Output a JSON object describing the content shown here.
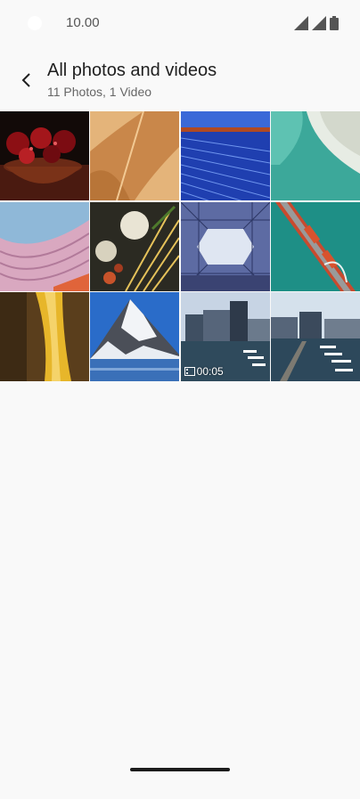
{
  "status_bar": {
    "time": "10.00",
    "icons": [
      "signal-icon",
      "signal-icon",
      "battery-icon"
    ]
  },
  "header": {
    "back_icon": "chevron-left-icon",
    "title": "All photos and videos",
    "subtitle": "11 Photos, 1 Video"
  },
  "grid": {
    "items": [
      {
        "kind": "photo",
        "subject": "pomegranates"
      },
      {
        "kind": "photo",
        "subject": "sand-dune"
      },
      {
        "kind": "photo",
        "subject": "blue-architecture"
      },
      {
        "kind": "photo",
        "subject": "aerial-coast"
      },
      {
        "kind": "photo",
        "subject": "pink-waves"
      },
      {
        "kind": "photo",
        "subject": "garlic-pasta"
      },
      {
        "kind": "photo",
        "subject": "glass-atrium"
      },
      {
        "kind": "photo",
        "subject": "bridge-aerial"
      },
      {
        "kind": "photo",
        "subject": "yellow-canyon"
      },
      {
        "kind": "photo",
        "subject": "matterhorn"
      },
      {
        "kind": "video",
        "subject": "harbor-buildings",
        "duration": "00:05"
      },
      {
        "kind": "photo",
        "subject": "marina"
      }
    ]
  },
  "colors": {
    "background": "#f9f9f9",
    "text_primary": "#1f1f1f",
    "text_secondary": "#666666"
  }
}
